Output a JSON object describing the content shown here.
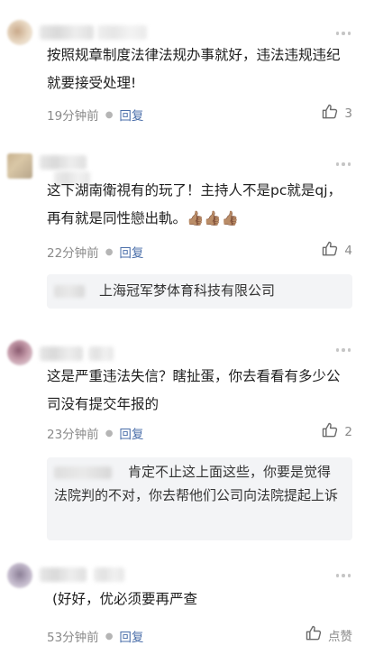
{
  "comments": [
    {
      "text": "按照规章制度法律法规办事就好，违法违规违纪就要接受处理!",
      "time": "19分钟前",
      "reply_label": "回复",
      "likes": "3"
    },
    {
      "text": "这下湖南衛視有的玩了！主持人不是pc就是qj，再有就是同性戀出軌。👍🏽👍🏽👍🏽",
      "time": "22分钟前",
      "reply_label": "回复",
      "likes": "4",
      "reply": {
        "text": "上海冠军梦体育科技有限公司"
      }
    },
    {
      "text": "这是严重违法失信？瞎扯蛋，你去看看有多少公司没有提交年报的",
      "time": "23分钟前",
      "reply_label": "回复",
      "likes": "2",
      "reply": {
        "text": "肯定不止这上面这些，你要是觉得法院判的不对，你去帮他们公司向法院提起上诉"
      }
    },
    {
      "text": "(好好，优必须要再严查",
      "time": "53分钟前",
      "reply_label": "回复",
      "likes": "点赞"
    }
  ],
  "icons": {
    "like": "thumbs-up-outline-icon",
    "more": "more-dots-icon"
  },
  "colors": {
    "reply_link": "#4a6ea9",
    "meta_gray": "#8a8a8a",
    "reply_bg": "#f3f4f6"
  }
}
